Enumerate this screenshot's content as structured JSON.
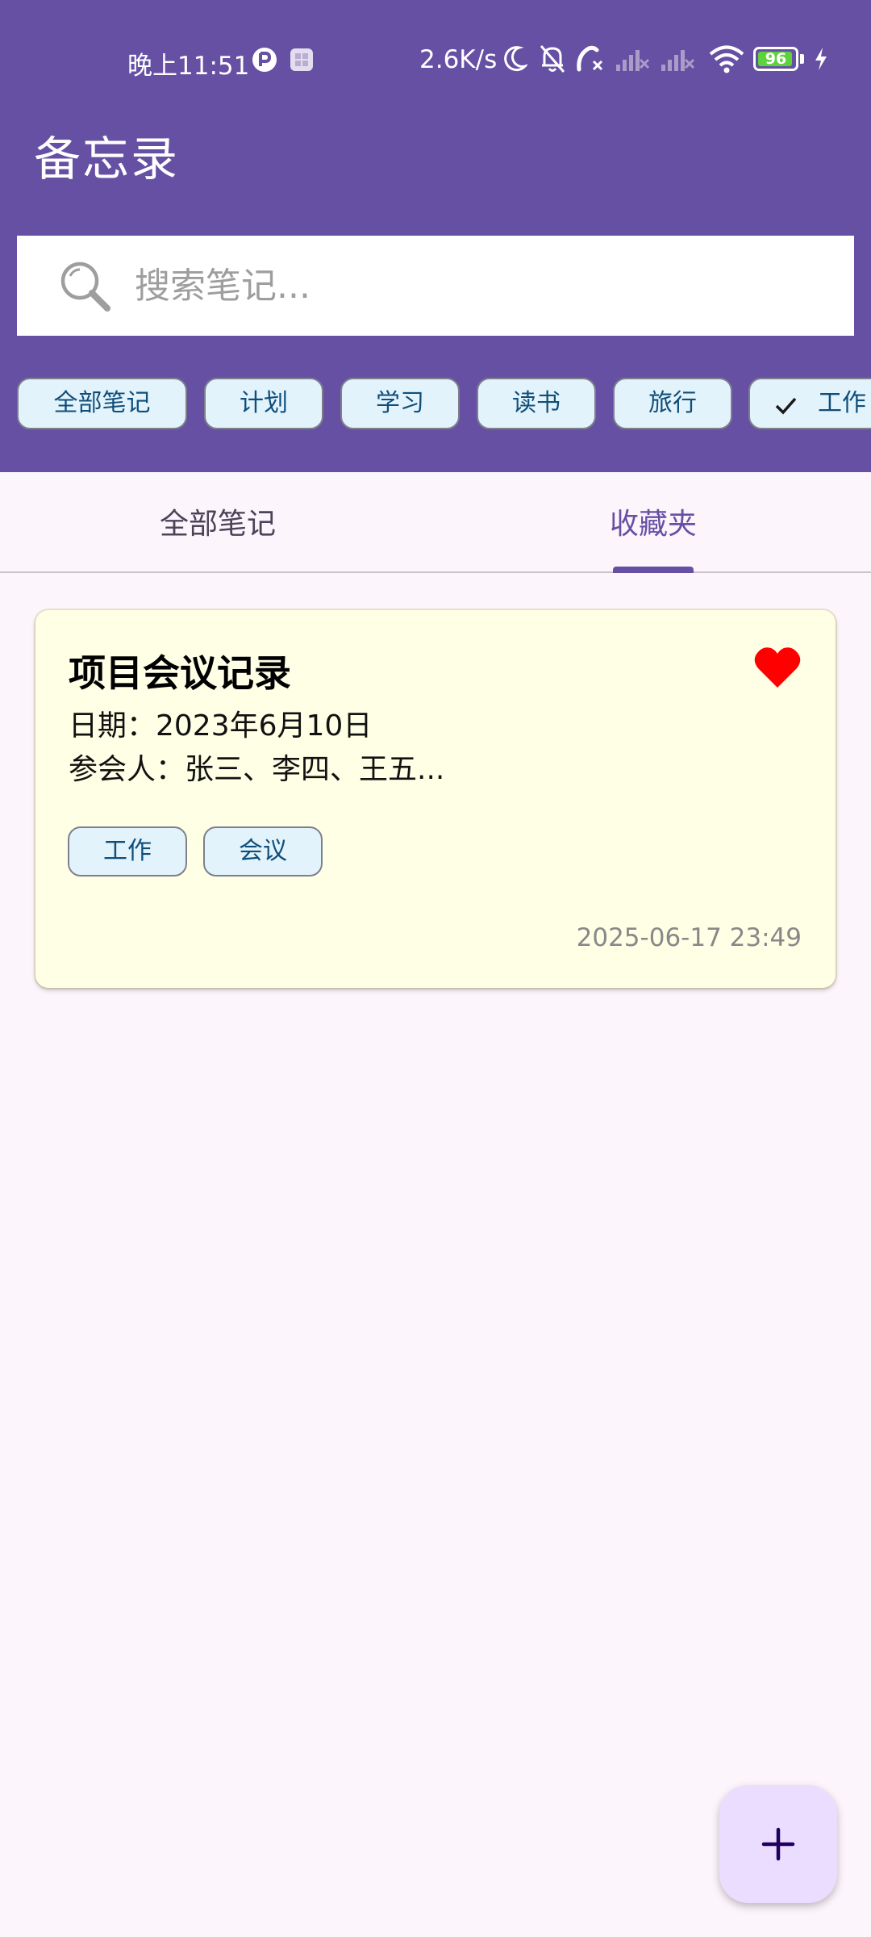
{
  "status_bar": {
    "time": "晚上11:51",
    "net_speed": "2.6K/s",
    "battery_level": "96",
    "battery_fraction": 0.96,
    "icons": [
      "app-notify-icon",
      "app-square-icon",
      "moon-icon",
      "bell-off-icon",
      "call-missed-icon",
      "signal-off-icon",
      "signal-off-icon",
      "wifi-icon",
      "battery-icon",
      "charging-icon"
    ]
  },
  "app": {
    "title": "备忘录"
  },
  "search": {
    "placeholder": "搜索笔记...",
    "value": ""
  },
  "filter_chips": [
    {
      "label": "全部笔记",
      "selected": false
    },
    {
      "label": "计划",
      "selected": false
    },
    {
      "label": "学习",
      "selected": false
    },
    {
      "label": "读书",
      "selected": false
    },
    {
      "label": "旅行",
      "selected": false
    },
    {
      "label": "工作",
      "selected": true
    }
  ],
  "tabs": [
    {
      "label": "全部笔记",
      "active": false
    },
    {
      "label": "收藏夹",
      "active": true
    }
  ],
  "notes": [
    {
      "title": "项目会议记录",
      "line1": "日期：2023年6月10日",
      "line2": "参会人：张三、李四、王五...",
      "tags": [
        "工作",
        "会议"
      ],
      "timestamp": "2025-06-17 23:49",
      "favorite": true
    }
  ],
  "fab": {
    "icon": "plus-icon"
  },
  "colors": {
    "primary": "#6650a4",
    "background": "#fcf5fc",
    "chip_bg": "#e2f3fc",
    "card_bg": "#ffffe6",
    "favorite": "#ff0000",
    "fab_bg": "#eaddff"
  }
}
